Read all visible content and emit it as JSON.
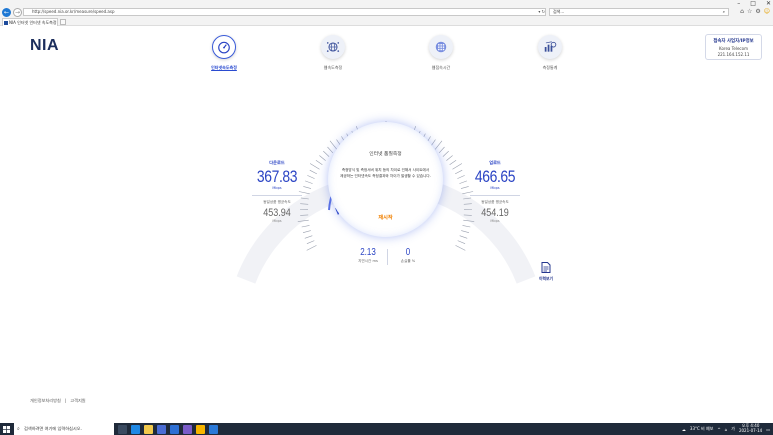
{
  "browser": {
    "url": "http://speed.nia.or.kr/measure/speed.asp",
    "search_placeholder": "검색...",
    "tab_title": "NIA 인터넷 인터넷 속도측정"
  },
  "site": {
    "logo": "NIA",
    "menu": [
      {
        "label": "인터넷속도측정",
        "icon": "speedometer-icon",
        "active": true
      },
      {
        "label": "웹속도측정",
        "icon": "globe-network-icon",
        "active": false
      },
      {
        "label": "웹접속시간",
        "icon": "grid-globe-icon",
        "active": false
      },
      {
        "label": "측정통계",
        "icon": "statistics-icon",
        "active": false
      }
    ],
    "isp": {
      "title": "접속자 사업자/IP정보",
      "name": "Korea Telecom",
      "ip": "221.164.152.11"
    }
  },
  "measure": {
    "center_title": "인터넷 품질측정",
    "center_body": "측정방식 및 측정서버 위치 등의 차이로 인해서 사이트에서 제공하는 인터넷속도 측정결과와 차이가 발생할 수 있습니다.",
    "retry_label": "재시작",
    "download": {
      "label": "다운로드",
      "value": "367.83",
      "unit": "Mbps",
      "avg_label": "동일상품 평균속도",
      "avg_value": "453.94",
      "avg_unit": "Mbps"
    },
    "upload": {
      "label": "업로드",
      "value": "466.65",
      "unit": "Mbps",
      "avg_label": "동일상품 평균속도",
      "avg_value": "454.19",
      "avg_unit": "Mbps"
    },
    "latency": {
      "value": "2.13",
      "label": "지연시간 ms"
    },
    "loss": {
      "value": "0",
      "label": "손실률 %"
    },
    "report_label": "이력보기"
  },
  "footer": {
    "links": [
      "개인정보처리방침",
      "고객지원"
    ]
  },
  "taskbar": {
    "search_placeholder": "검색하려면 여기에 입력하십시오.",
    "weather": "33°C 비 예보",
    "time": "오후 4:40",
    "date": "2021-07-14",
    "lang": "가"
  },
  "colors": {
    "brand_navy": "#1b2d5c",
    "accent_blue": "#2b44c4",
    "accent_orange": "#f08000"
  }
}
